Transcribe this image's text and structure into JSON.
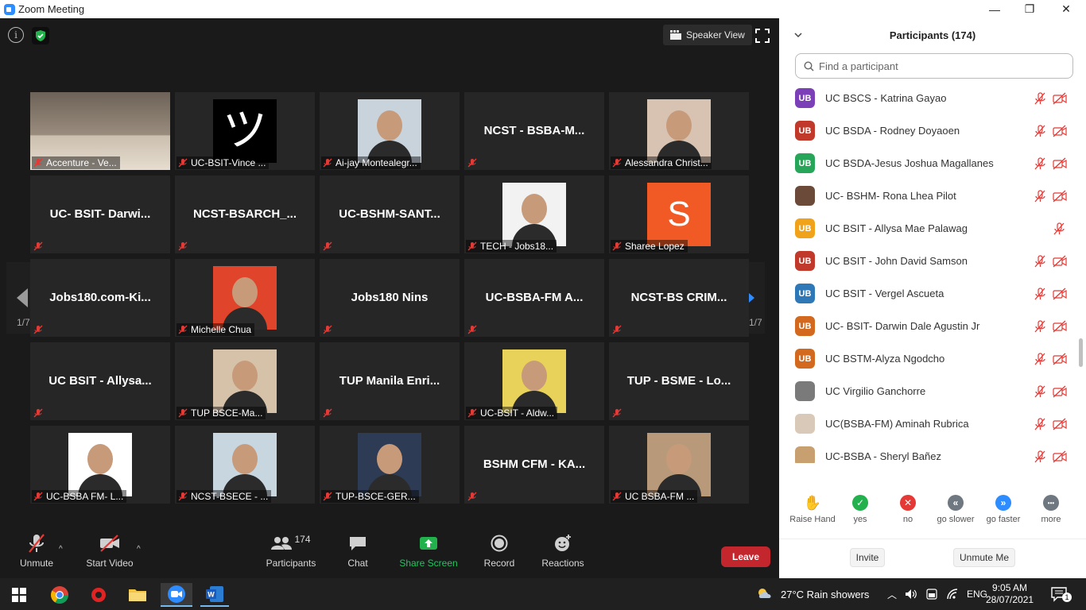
{
  "window": {
    "title": "Zoom Meeting",
    "minimize": "—",
    "restore": "❐",
    "close": "✕"
  },
  "top": {
    "info": "i",
    "speaker_view": "Speaker View"
  },
  "tiles": [
    {
      "name": "Accenture - Ve...",
      "kind": "image",
      "big": ""
    },
    {
      "name": "UC-BSIT-Vince ...",
      "kind": "image",
      "big": ""
    },
    {
      "name": "Ai-jay Montealegr...",
      "kind": "image",
      "big": ""
    },
    {
      "name": "",
      "kind": "name",
      "big": "NCST - BSBA-M..."
    },
    {
      "name": "Alessandra Christ...",
      "kind": "image",
      "big": ""
    },
    {
      "name": "",
      "kind": "name",
      "big": "UC- BSIT- Darwi..."
    },
    {
      "name": "",
      "kind": "name",
      "big": "NCST-BSARCH_..."
    },
    {
      "name": "",
      "kind": "name",
      "big": "UC-BSHM-SANT..."
    },
    {
      "name": "TECH - Jobs18...",
      "kind": "image",
      "big": ""
    },
    {
      "name": "Sharee Lopez",
      "kind": "image",
      "big": ""
    },
    {
      "name": "",
      "kind": "name",
      "big": "Jobs180.com-Ki..."
    },
    {
      "name": "Michelle Chua",
      "kind": "image",
      "big": ""
    },
    {
      "name": "",
      "kind": "name",
      "big": "Jobs180 Nins"
    },
    {
      "name": "",
      "kind": "name",
      "big": "UC-BSBA-FM A..."
    },
    {
      "name": "",
      "kind": "name",
      "big": "NCST-BS CRIM..."
    },
    {
      "name": "",
      "kind": "name",
      "big": "UC BSIT - Allysa..."
    },
    {
      "name": "TUP BSCE-Ma...",
      "kind": "image",
      "big": ""
    },
    {
      "name": "",
      "kind": "name",
      "big": "TUP Manila Enri..."
    },
    {
      "name": "UC-BSIT - Aldw...",
      "kind": "image",
      "big": ""
    },
    {
      "name": "",
      "kind": "name",
      "big": "TUP - BSME - Lo..."
    },
    {
      "name": "UC-BSBA FM- L...",
      "kind": "image",
      "big": ""
    },
    {
      "name": "NCST-BSECE - ...",
      "kind": "image",
      "big": ""
    },
    {
      "name": "TUP-BSCE-GER...",
      "kind": "image",
      "big": ""
    },
    {
      "name": "",
      "kind": "name",
      "big": "BSHM CFM - KA..."
    },
    {
      "name": "UC BSBA-FM ...",
      "kind": "image",
      "big": ""
    }
  ],
  "sharee_initial": "S",
  "pagination": {
    "left": "1/7",
    "right": "1/7"
  },
  "toolbar": {
    "unmute": "Unmute",
    "start_video": "Start Video",
    "participants": "Participants",
    "participants_count": "174",
    "chat": "Chat",
    "share_screen": "Share Screen",
    "record": "Record",
    "reactions": "Reactions",
    "leave": "Leave"
  },
  "panel": {
    "title": "Participants (174)",
    "search_placeholder": "Find a participant",
    "participants": [
      {
        "initials": "UB",
        "color": "#7b3fb7",
        "name": "UC BSCS - Katrina Gayao",
        "video": true
      },
      {
        "initials": "UB",
        "color": "#c0392b",
        "name": "UC BSDA - Rodney Doyaoen",
        "video": true
      },
      {
        "initials": "UB",
        "color": "#27a558",
        "name": "UC BSDA-Jesus Joshua Magallanes",
        "video": true
      },
      {
        "initials": "",
        "color": "#6b4a3a",
        "name": "UC- BSHM- Rona Lhea Pilot",
        "video": true
      },
      {
        "initials": "UB",
        "color": "#f0a21a",
        "name": "UC BSIT - Allysa Mae Palawag",
        "video": false
      },
      {
        "initials": "UB",
        "color": "#c0392b",
        "name": "UC BSIT - John David Samson",
        "video": true
      },
      {
        "initials": "UB",
        "color": "#2e78b8",
        "name": "UC BSIT - Vergel Ascueta",
        "video": true
      },
      {
        "initials": "UB",
        "color": "#d2691e",
        "name": "UC- BSIT- Darwin Dale Agustin Jr",
        "video": true
      },
      {
        "initials": "UB",
        "color": "#d2691e",
        "name": "UC BSTM-Alyza Ngodcho",
        "video": true
      },
      {
        "initials": "",
        "color": "#7a7a7a",
        "name": "UC Virgilio Ganchorre",
        "video": true
      },
      {
        "initials": "",
        "color": "#d9c9b8",
        "name": "UC(BSBA-FM) Aminah Rubrica",
        "video": true
      },
      {
        "initials": "",
        "color": "#c8a070",
        "name": "UC-BSBA - Sheryl Bañez",
        "video": true
      }
    ],
    "reactions": [
      {
        "label": "Raise Hand",
        "color": "#2d8cff",
        "glyph": "✋"
      },
      {
        "label": "yes",
        "color": "#22b14c",
        "glyph": "✓"
      },
      {
        "label": "no",
        "color": "#e53935",
        "glyph": "✕"
      },
      {
        "label": "go slower",
        "color": "#6f7780",
        "glyph": "«"
      },
      {
        "label": "go faster",
        "color": "#2d8cff",
        "glyph": "»"
      },
      {
        "label": "more",
        "color": "#6f7780",
        "glyph": "•••"
      }
    ],
    "invite": "Invite",
    "unmute_me": "Unmute Me"
  },
  "taskbar": {
    "weather": "27°C  Rain showers",
    "lang": "ENG",
    "time": "9:05 AM",
    "date": "28/07/2021",
    "notifications": "1"
  }
}
